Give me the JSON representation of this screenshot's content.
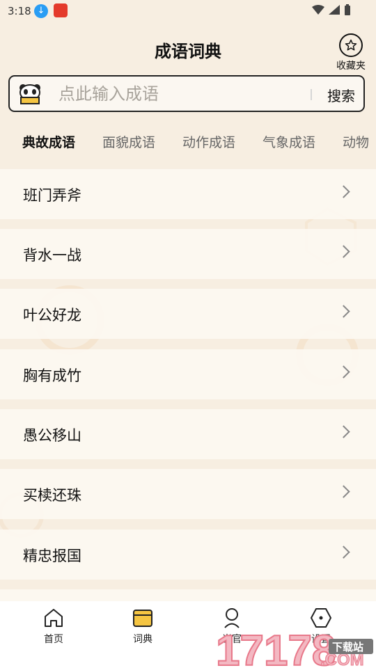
{
  "status_bar": {
    "time": "3:18"
  },
  "header": {
    "title": "成语词典",
    "favorites_label": "收藏夹"
  },
  "search": {
    "placeholder": "点此输入成语",
    "button_label": "搜索"
  },
  "tabs": [
    {
      "label": "典故成语",
      "active": true
    },
    {
      "label": "面貌成语",
      "active": false
    },
    {
      "label": "动作成语",
      "active": false
    },
    {
      "label": "气象成语",
      "active": false
    },
    {
      "label": "动物",
      "active": false
    }
  ],
  "idioms": [
    "班门弄斧",
    "背水一战",
    "叶公好龙",
    "胸有成竹",
    "愚公移山",
    "买椟还珠",
    "精忠报国"
  ],
  "bottom_nav": [
    {
      "label": "首页",
      "icon": "home-icon",
      "active": false
    },
    {
      "label": "词典",
      "icon": "dictionary-icon",
      "active": true
    },
    {
      "label": "当官",
      "icon": "person-icon",
      "active": false
    },
    {
      "label": "设置",
      "icon": "settings-icon",
      "active": false
    }
  ],
  "watermark": {
    "site": "17178",
    "suffix": ".COM",
    "badge": "下载站"
  },
  "colors": {
    "background": "#f7eee1",
    "accent": "#f5c542",
    "watermark": "#e8788a"
  }
}
